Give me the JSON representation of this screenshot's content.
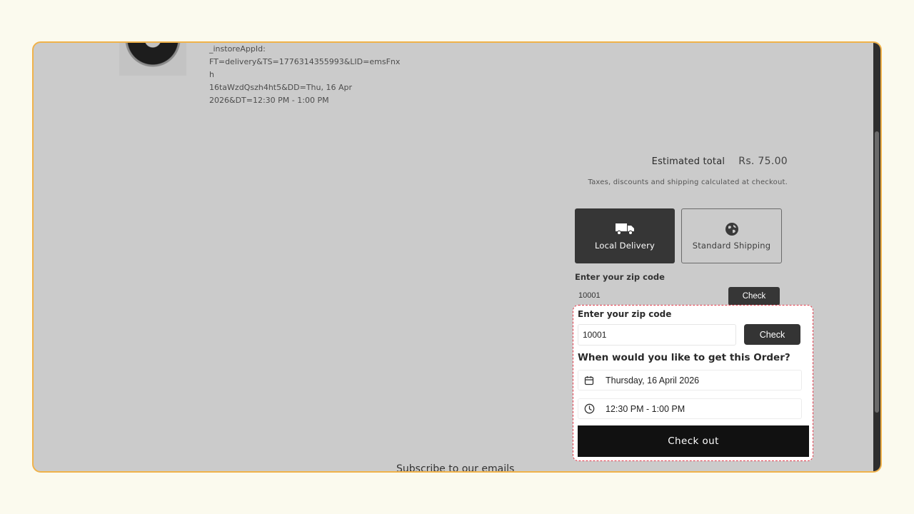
{
  "cart_item": {
    "properties_lines": [
      "_instoreAppId:",
      "FT=delivery&TS=1776314355993&LID=emsFnxh",
      "16taWzdQszh4ht5&DD=Thu, 16 Apr",
      "2026&DT=12:30 PM - 1:00 PM"
    ]
  },
  "summary": {
    "estimated_total_label": "Estimated total",
    "estimated_total_value": "Rs. 75.00",
    "tax_note": "Taxes, discounts and shipping calculated at checkout."
  },
  "shipping_options": [
    {
      "label": "Local Delivery",
      "icon": "truck-icon",
      "selected": true
    },
    {
      "label": "Standard Shipping",
      "icon": "globe-icon",
      "selected": false
    }
  ],
  "zip_background": {
    "label": "Enter your zip code",
    "value": "10001",
    "check_label": "Check"
  },
  "delivery_popup": {
    "zip_label": "Enter your zip code",
    "zip_value": "10001",
    "check_label": "Check",
    "question": "When would you like to get this Order?",
    "date_value": "Thursday, 16 April 2026",
    "time_value": "12:30 PM - 1:00 PM",
    "checkout_label": "Check out"
  },
  "footer": {
    "subscribe_heading": "Subscribe to our emails"
  },
  "colors": {
    "frame_border": "#f0b24a",
    "overlay_bg": "#cbcbcb",
    "popup_border": "#e03a4a",
    "button_dark": "#343434",
    "checkout_bg": "#111111"
  }
}
